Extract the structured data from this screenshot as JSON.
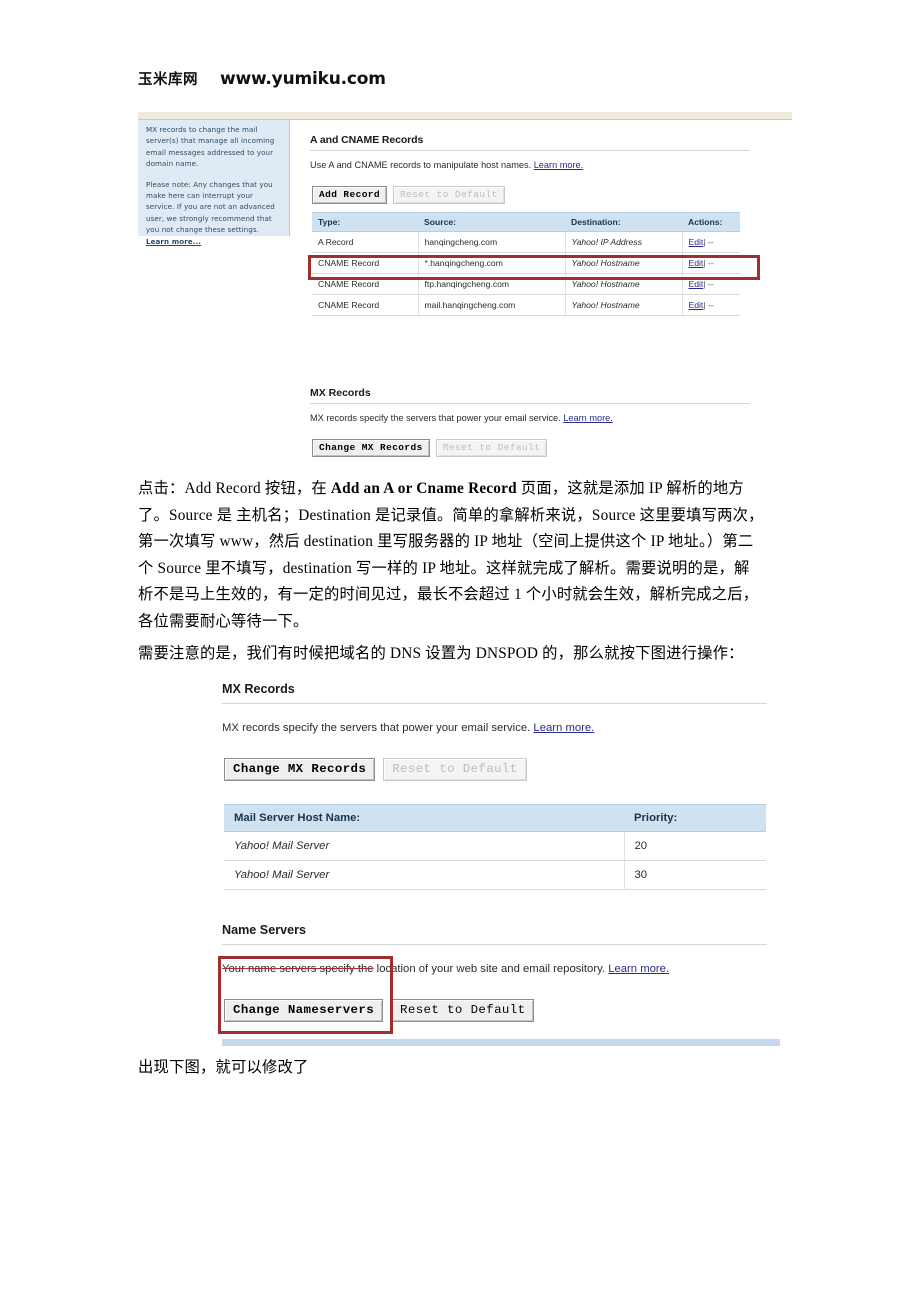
{
  "header": {
    "brand_cn": "玉米库网",
    "url": "www.yumiku.com"
  },
  "screenshot1": {
    "sidenote": {
      "para1": "MX records to change the mail server(s) that manage all incoming email messages addressed to your domain name.",
      "para2_text": "Please note: Any changes that you make here can interrupt your service. If you are not an advanced user, we strongly recommend that you not change these settings. ",
      "para2_link": "Learn more..."
    },
    "a_cname": {
      "title": "A and CNAME Records",
      "desc": "Use A and CNAME records to manipulate host names.",
      "desc_link": "Learn more.",
      "buttons": {
        "add_record": "Add Record",
        "reset": "Reset to Default"
      },
      "table": {
        "headers": [
          "Type:",
          "Source:",
          "Destination:",
          "Actions:"
        ],
        "rows": [
          {
            "type": "A Record",
            "source": "hanqingcheng.com",
            "destination": "Yahoo! IP Address",
            "edit": "Edit",
            "sep": "| --",
            "highlighted": true
          },
          {
            "type": "CNAME Record",
            "source": "*.hanqingcheng.com",
            "destination": "Yahoo! Hostname",
            "edit": "Edit",
            "sep": "| --",
            "highlighted": false
          },
          {
            "type": "CNAME Record",
            "source": "ftp.hanqingcheng.com",
            "destination": "Yahoo! Hostname",
            "edit": "Edit",
            "sep": "| --",
            "highlighted": false
          },
          {
            "type": "CNAME Record",
            "source": "mail.hanqingcheng.com",
            "destination": "Yahoo! Hostname",
            "edit": "Edit",
            "sep": "| --",
            "highlighted": false
          }
        ]
      }
    },
    "mx": {
      "title": "MX Records",
      "desc": "MX records specify the servers that power your email service.",
      "desc_link": "Learn more.",
      "buttons": {
        "change": "Change MX Records",
        "reset": "Reset to Default"
      }
    }
  },
  "paragraph1": {
    "line1_a": "点击：Add Record 按钮，在 ",
    "line1_b": "Add an A or Cname Record",
    "line1_c": " 页面，这就是添加 IP 解析的地方",
    "line2": "了。Source 是 主机名；Destination 是记录值。简单的拿解析来说，Source 这里要填写两次，",
    "line3": "第一次填写 www，然后 destination 里写服务器的 IP 地址（空间上提供这个 IP 地址。）第二",
    "line4": "个 Source 里不填写，destination 写一样的 IP 地址。这样就完成了解析。需要说明的是，解",
    "line5": "析不是马上生效的，有一定的时间见过，最长不会超过 1 个小时就会生效，解析完成之后，",
    "line6": "各位需要耐心等待一下。"
  },
  "paragraph2": {
    "line1": "需要注意的是，我们有时候把域名的 DNS 设置为 DNSPOD 的，那么就按下图进行操作："
  },
  "screenshot2": {
    "mx": {
      "title": "MX Records",
      "desc": "MX records specify the servers that power your email service.",
      "desc_link": "Learn more.",
      "buttons": {
        "change": "Change MX Records",
        "reset": "Reset to Default"
      },
      "table": {
        "headers": [
          "Mail Server Host Name:",
          "Priority:"
        ],
        "rows": [
          {
            "host": "Yahoo! Mail Server",
            "priority": "20"
          },
          {
            "host": "Yahoo! Mail Server",
            "priority": "30"
          }
        ]
      }
    },
    "nameservers": {
      "title": "Name Servers",
      "desc_struck": "Your name servers specify the",
      "desc_rest": " location of your web site and email repository.",
      "desc_link": "Learn more.",
      "buttons": {
        "change": "Change Nameservers",
        "reset": "Reset to Default"
      }
    }
  },
  "paragraph3": {
    "line1": "出现下图，就可以修改了"
  },
  "colors": {
    "annotation_red": "#9c3030",
    "table_header_blue": "#cfe2f1",
    "sidenote_blue": "#dfeaf4",
    "link_blue": "#2a2a8a",
    "topbar_cream": "#eeeade",
    "bottom_band_blue": "#c5d8ec"
  }
}
